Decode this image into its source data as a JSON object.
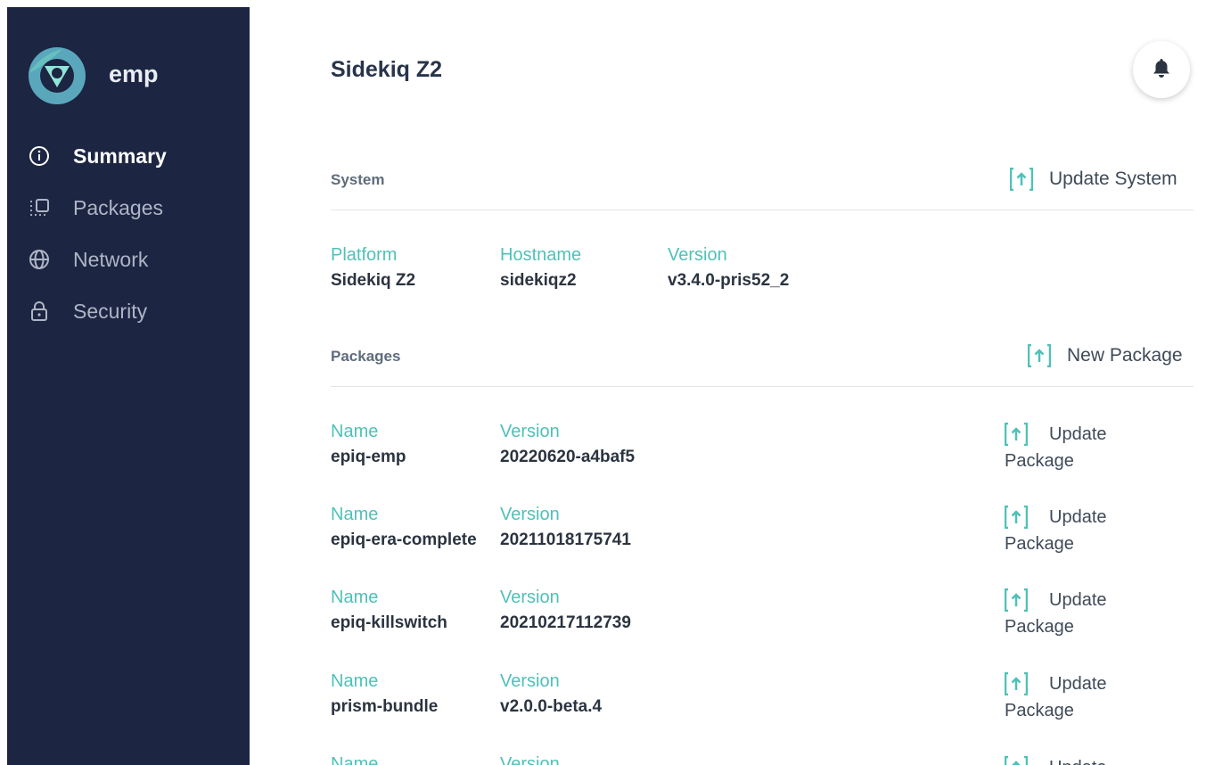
{
  "app": {
    "name": "emp"
  },
  "sidebar": {
    "items": [
      {
        "label": "Summary",
        "icon": "info-icon",
        "active": true
      },
      {
        "label": "Packages",
        "icon": "packages-icon",
        "active": false
      },
      {
        "label": "Network",
        "icon": "globe-icon",
        "active": false
      },
      {
        "label": "Security",
        "icon": "lock-icon",
        "active": false
      }
    ]
  },
  "header": {
    "title": "Sidekiq Z2",
    "notification_icon": "bell-icon"
  },
  "system": {
    "section_label": "System",
    "update_label": "Update System",
    "fields": [
      {
        "key": "Platform",
        "value": "Sidekiq Z2"
      },
      {
        "key": "Hostname",
        "value": "sidekiqz2"
      },
      {
        "key": "Version",
        "value": "v3.4.0-pris52_2"
      }
    ]
  },
  "packages": {
    "section_label": "Packages",
    "new_label": "New Package",
    "name_key": "Name",
    "version_key": "Version",
    "update_line1": "Update",
    "update_line2": "Package",
    "items": [
      {
        "name": "epiq-emp",
        "version": "20220620-a4baf5"
      },
      {
        "name": "epiq-era-complete",
        "version": "20211018175741"
      },
      {
        "name": "epiq-killswitch",
        "version": "20210217112739"
      },
      {
        "name": "prism-bundle",
        "version": "v2.0.0-beta.4"
      }
    ]
  },
  "colors": {
    "sidebar": "#1c2542",
    "accent": "#4fc1b8",
    "text": "#2b3440"
  }
}
